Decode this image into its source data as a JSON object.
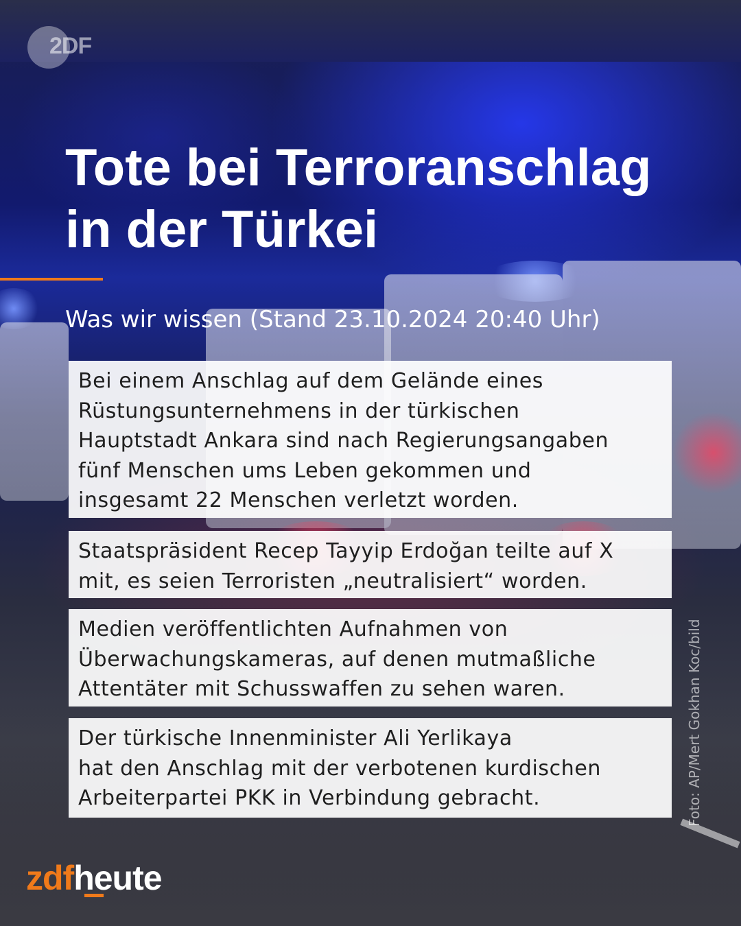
{
  "logo": {
    "text": "2DF"
  },
  "headline": {
    "line1": "Tote bei Terroranschlag",
    "line2": "in der Türkei"
  },
  "subtitle": "Was wir wissen (Stand 23.10.2024 20:40 Uhr)",
  "facts": [
    {
      "lines": [
        "Bei einem Anschlag auf dem Gelände eines",
        "Rüstungsunternehmens in der türkischen",
        "Hauptstadt Ankara sind nach Regierungsangaben",
        "fünf Menschen ums Leben gekommen und",
        "insgesamt 22 Menschen verletzt worden."
      ]
    },
    {
      "lines": [
        "Staatspräsident Recep Tayyip Erdoğan teilte auf X",
        "mit, es seien Terroristen „neutralisiert“ worden."
      ]
    },
    {
      "lines": [
        "Medien veröffentlichten Aufnahmen von",
        "Überwachungskameras, auf denen mutmaßliche",
        "Attentäter mit Schusswaffen zu sehen waren."
      ]
    },
    {
      "lines": [
        "Der türkische Innenminister Ali Yerlikaya",
        "hat den Anschlag mit der verbotenen kurdischen",
        "Arbeiterpartei PKK in Verbindung gebracht."
      ]
    }
  ],
  "photo_credit": "Foto: AP/Mert Gokhan Koc/bild",
  "brand": {
    "part1": "zdf",
    "part2": "heute"
  },
  "colors": {
    "accent": "#f07a1a",
    "headline": "#ffffff",
    "card_bg": "#ffffff",
    "card_text": "#1f1f1f"
  }
}
